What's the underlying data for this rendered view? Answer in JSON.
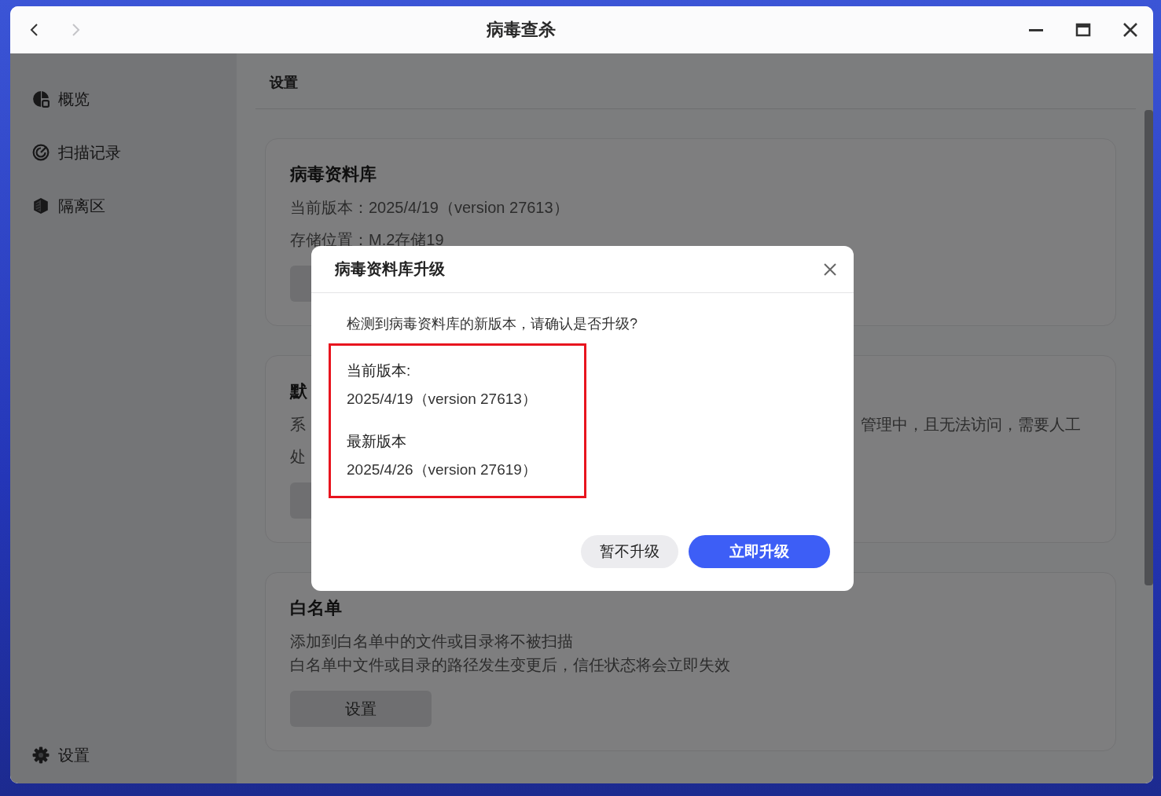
{
  "window": {
    "title": "病毒查杀",
    "nav": [
      {
        "kind": "back",
        "disabled": false
      },
      {
        "kind": "forward",
        "disabled": true
      }
    ]
  },
  "sidebar": {
    "items": [
      {
        "kind": "overview",
        "label": "概览"
      },
      {
        "kind": "records",
        "label": "扫描记录"
      },
      {
        "kind": "quarantine",
        "label": "隔离区"
      }
    ],
    "footer": {
      "kind": "settings",
      "label": "设置"
    }
  },
  "main": {
    "heading": "设置",
    "cards": [
      {
        "title": "病毒资料库",
        "lines": [
          {
            "text": "当前版本：2025/4/19（version 27613）"
          },
          {
            "text": "存储位置：M.2存储19"
          }
        ],
        "has_button": true
      },
      {
        "title": "默",
        "lines": [
          {
            "text": "系",
            "tail": "管理中，且无法访问，需要人工"
          },
          {
            "text": "处"
          }
        ],
        "has_button": true
      },
      {
        "title": "白名单",
        "lines": [
          {
            "text": "添加到白名单中的文件或目录将不被扫描"
          },
          {
            "text": "白名单中文件或目录的路径发生变更后，信任状态将会立即失效"
          }
        ],
        "button": "设置"
      }
    ]
  },
  "dialog": {
    "title": "病毒资料库升级",
    "message": "检测到病毒资料库的新版本，请确认是否升级?",
    "versions": [
      {
        "label": "当前版本:",
        "value": "2025/4/19（version 27613）"
      },
      {
        "label": "最新版本",
        "value": "2025/4/26（version 27619）"
      }
    ],
    "buttons": [
      {
        "label": "暂不升级",
        "kind": "secondary"
      },
      {
        "label": "立即升级",
        "kind": "primary"
      }
    ]
  }
}
